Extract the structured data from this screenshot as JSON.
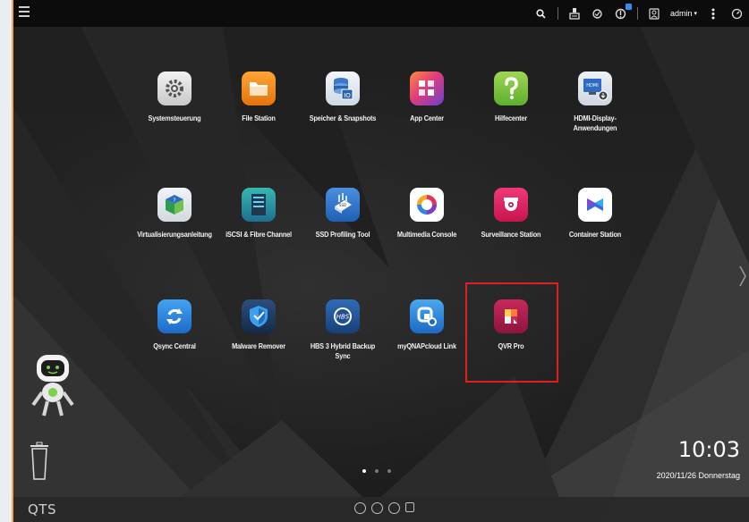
{
  "topbar": {
    "user_label": "admin",
    "icons": [
      "menu-icon",
      "search-icon",
      "tasks-icon",
      "sync-icon",
      "notification-icon",
      "user-icon",
      "more-icon",
      "dashboard-icon"
    ]
  },
  "apps": [
    {
      "name": "systemsteuerung",
      "label": "Systemsteuerung",
      "icon": "gear-icon",
      "color": "#9a9a9a"
    },
    {
      "name": "file-station",
      "label": "File Station",
      "icon": "folder-icon",
      "color": "#f08a1c"
    },
    {
      "name": "speicher-snapshots",
      "label": "Speicher & Snapshots",
      "icon": "storage-icon",
      "color": "#3b78c9"
    },
    {
      "name": "app-center",
      "label": "App Center",
      "icon": "app-center-icon",
      "color": "#7b3fc6"
    },
    {
      "name": "hilfecenter",
      "label": "Hilfecenter",
      "icon": "help-icon",
      "color": "#7cc242"
    },
    {
      "name": "hdmi-display",
      "label": "HDMI-Display-\nAnwendungen",
      "icon": "hdmi-icon",
      "color": "#3c7bd0"
    },
    {
      "name": "virtualisierungsanleitung",
      "label": "Virtualisierungsanleitung",
      "icon": "cube-icon",
      "color": "#3aa45a"
    },
    {
      "name": "iscsi-fibre",
      "label": "iSCSI & Fibre Channel",
      "icon": "server-icon",
      "color": "#2a9d9a"
    },
    {
      "name": "ssd-profiling",
      "label": "SSD Profiling Tool",
      "icon": "ssd-icon",
      "color": "#2d6fc7"
    },
    {
      "name": "multimedia-console",
      "label": "Multimedia Console",
      "icon": "multimedia-icon",
      "color": "#ffffff"
    },
    {
      "name": "surveillance-station",
      "label": "Surveillance Station",
      "icon": "camera-icon",
      "color": "#e0245e"
    },
    {
      "name": "container-station",
      "label": "Container Station",
      "icon": "container-icon",
      "color": "#ffffff"
    },
    {
      "name": "qsync-central",
      "label": "Qsync Central",
      "icon": "qsync-icon",
      "color": "#2f86de"
    },
    {
      "name": "malware-remover",
      "label": "Malware Remover",
      "icon": "shield-icon",
      "color": "#2d74c8"
    },
    {
      "name": "hbs3",
      "label": "HBS 3 Hybrid Backup\nSync",
      "icon": "hbs-icon",
      "color": "#245fa8"
    },
    {
      "name": "myqnapcloud-link",
      "label": "myQNAPcloud Link",
      "icon": "cloud-link-icon",
      "color": "#2f8ad8"
    },
    {
      "name": "qvr-pro",
      "label": "QVR Pro",
      "icon": "qvr-icon",
      "color": "#b3204f"
    }
  ],
  "clock": {
    "time": "10:03",
    "date": "2020/11/26 Donnerstag"
  },
  "bottombar": {
    "brand": "QTS"
  },
  "pager": {
    "pages": 3,
    "active": 0
  }
}
